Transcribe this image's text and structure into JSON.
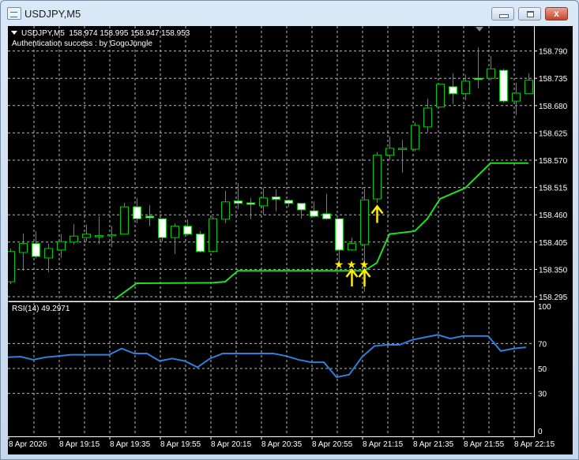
{
  "window": {
    "title": "USDJPY,M5",
    "close_label": "x"
  },
  "header": {
    "symbol": "USDJPY,M5",
    "ohlc": "158.974 158.995 158.947 158.953",
    "notice": "Authentication success : by GogoJungle"
  },
  "rsi_header": "RSI(14) 49.2971",
  "colors": {
    "bull": "#00cc00",
    "bear_fill": "#ffffff",
    "supertrend": "#22dd22",
    "rsi": "#2f7fdc",
    "signal": "#ffee00",
    "grid": "#b8b8b8"
  },
  "chart_data": [
    {
      "type": "candlestick",
      "title": "USDJPY,M5",
      "price_ticks": [
        "158.790",
        "158.735",
        "158.680",
        "158.625",
        "158.570",
        "158.515",
        "158.460",
        "158.405",
        "158.350",
        "158.295"
      ],
      "ylim": [
        158.288,
        158.82
      ],
      "time_labels": [
        "8 Apr 2026",
        "8 Apr 19:15",
        "8 Apr 19:35",
        "8 Apr 19:55",
        "8 Apr 20:15",
        "8 Apr 20:35",
        "8 Apr 20:55",
        "8 Apr 21:15",
        "8 Apr 21:35",
        "8 Apr 21:55",
        "8 Apr 22:15"
      ],
      "ohlc": [
        [
          158.325,
          158.392,
          158.32,
          158.386
        ],
        [
          158.384,
          158.422,
          158.347,
          158.402
        ],
        [
          158.402,
          158.427,
          158.372,
          158.376
        ],
        [
          158.373,
          158.402,
          158.344,
          158.392
        ],
        [
          158.389,
          158.421,
          158.373,
          158.406
        ],
        [
          158.405,
          158.441,
          158.4,
          158.417
        ],
        [
          158.414,
          158.44,
          158.406,
          158.421
        ],
        [
          158.417,
          158.457,
          158.401,
          158.418
        ],
        [
          158.419,
          158.437,
          158.395,
          158.42
        ],
        [
          158.421,
          158.484,
          158.42,
          158.476
        ],
        [
          158.476,
          158.494,
          158.443,
          158.452
        ],
        [
          158.457,
          158.479,
          158.437,
          158.454
        ],
        [
          158.452,
          158.452,
          158.406,
          158.414
        ],
        [
          158.414,
          158.443,
          158.381,
          158.437
        ],
        [
          158.437,
          158.451,
          158.418,
          158.421
        ],
        [
          158.421,
          158.427,
          158.384,
          158.386
        ],
        [
          158.386,
          158.457,
          158.384,
          158.452
        ],
        [
          158.451,
          158.508,
          158.443,
          158.486
        ],
        [
          158.488,
          158.524,
          158.471,
          158.483
        ],
        [
          158.484,
          158.494,
          158.451,
          158.481
        ],
        [
          158.478,
          158.514,
          158.46,
          158.494
        ],
        [
          158.496,
          158.511,
          158.467,
          158.491
        ],
        [
          158.489,
          158.491,
          158.475,
          158.483
        ],
        [
          158.483,
          158.483,
          158.452,
          158.47
        ],
        [
          158.468,
          158.487,
          158.455,
          158.457
        ],
        [
          158.462,
          158.502,
          158.45,
          158.452
        ],
        [
          158.452,
          158.452,
          158.355,
          158.389
        ],
        [
          158.389,
          158.414,
          158.387,
          158.402
        ],
        [
          158.4,
          158.513,
          158.305,
          158.49
        ],
        [
          158.492,
          158.586,
          158.484,
          158.58
        ],
        [
          158.58,
          158.618,
          158.57,
          158.594
        ],
        [
          158.593,
          158.611,
          158.545,
          158.594
        ],
        [
          158.592,
          158.646,
          158.588,
          158.64
        ],
        [
          158.637,
          158.694,
          158.626,
          158.675
        ],
        [
          158.677,
          158.724,
          158.676,
          158.723
        ],
        [
          158.718,
          158.745,
          158.683,
          158.704
        ],
        [
          158.704,
          158.742,
          158.691,
          158.729
        ],
        [
          158.735,
          158.797,
          158.715,
          158.733
        ],
        [
          158.735,
          158.78,
          158.731,
          158.754
        ],
        [
          158.751,
          158.754,
          158.686,
          158.689
        ],
        [
          158.689,
          158.726,
          158.661,
          158.705
        ],
        [
          158.704,
          158.745,
          158.704,
          158.731
        ]
      ],
      "supertrend": [
        [
          8,
          158.285
        ],
        [
          10,
          158.322
        ],
        [
          16,
          158.323
        ],
        [
          17,
          158.325
        ],
        [
          18,
          158.347
        ],
        [
          28,
          158.347
        ],
        [
          29,
          158.363
        ],
        [
          30,
          158.421
        ],
        [
          32,
          158.427
        ],
        [
          33,
          158.452
        ],
        [
          34,
          158.492
        ],
        [
          36,
          158.514
        ],
        [
          38,
          158.564
        ],
        [
          41,
          158.564
        ]
      ],
      "star_signals": [
        {
          "bar": 26,
          "price": 158.36
        },
        {
          "bar": 27,
          "price": 158.36
        },
        {
          "bar": 28,
          "price": 158.36
        }
      ],
      "up_arrows": [
        {
          "bar": 27,
          "price": 158.33
        },
        {
          "bar": 28,
          "price": 158.33
        },
        {
          "bar": 29,
          "price": 158.458
        }
      ]
    },
    {
      "type": "line",
      "title": "RSI(14)",
      "value_label": "49.2971",
      "ylim": [
        0,
        100
      ],
      "ticks": [
        "100",
        "70",
        "50",
        "30",
        "0"
      ],
      "levels": [
        70,
        50,
        30
      ],
      "values": [
        59,
        59.5,
        57,
        59,
        60,
        61,
        61,
        61,
        61,
        66,
        62,
        62,
        56,
        58,
        56,
        51,
        58,
        62,
        62,
        62,
        62,
        62,
        60,
        57,
        55,
        55,
        43,
        45,
        59,
        68,
        69,
        69,
        73,
        75,
        77,
        74,
        76,
        76,
        76,
        64,
        66,
        67
      ]
    }
  ]
}
